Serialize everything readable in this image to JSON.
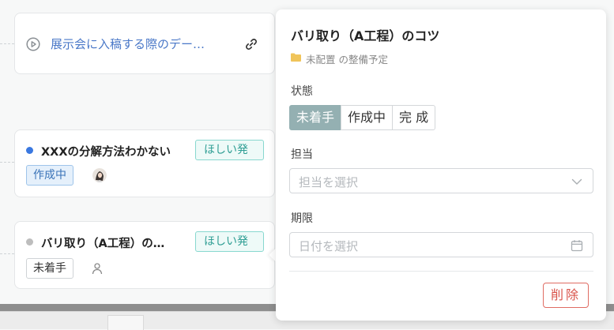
{
  "cards": [
    {
      "title": "展示会に入稿する際のデー…"
    },
    {
      "title": "XXXの分解方法わかない",
      "tag": "ほしい発",
      "status": "作成中",
      "dot_color": "#3a78e0"
    },
    {
      "title": "バリ取り（A工程）の…",
      "tag": "ほしい発",
      "status": "未着手",
      "dot_color": "#bdbdbd"
    }
  ],
  "popup": {
    "title": "バリ取り（A工程）のコツ",
    "folder": "未配置 の整備予定",
    "status_label": "状態",
    "status_options": [
      "未着手",
      "作成中",
      "完 成"
    ],
    "status_selected": "未着手",
    "assignee_label": "担当",
    "assignee_placeholder": "担当を選択",
    "due_label": "期限",
    "due_placeholder": "日付を選択",
    "delete_label": "削除"
  },
  "colors": {
    "accent_active": "#94b0b2",
    "tag_teal": "#2f9e94",
    "link_blue": "#4a78c8",
    "delete_red": "#d9534a"
  },
  "icons": [
    "play-circle-icon",
    "link-icon",
    "avatar",
    "person-icon",
    "folder-icon",
    "chevron-down-icon",
    "calendar-icon"
  ]
}
